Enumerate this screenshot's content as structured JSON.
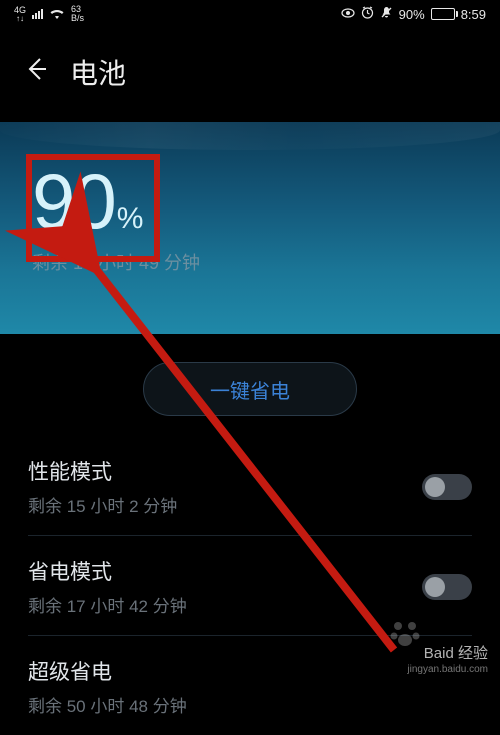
{
  "status_bar": {
    "network_type": "4G",
    "speed_value": "63",
    "speed_unit": "B/s",
    "battery_percent": "90%",
    "time": "8:59"
  },
  "header": {
    "title": "电池"
  },
  "hero": {
    "percent": "90",
    "percent_symbol": "%",
    "remaining": "剩余 15 小时 49 分钟"
  },
  "actions": {
    "one_key_save": "一键省电"
  },
  "settings": [
    {
      "title": "性能模式",
      "sub": "剩余 15 小时 2 分钟"
    },
    {
      "title": "省电模式",
      "sub": "剩余 17 小时 42 分钟"
    },
    {
      "title": "超级省电",
      "sub": "剩余 50 小时 48 分钟"
    }
  ],
  "watermark": {
    "brand": "Baid 经验",
    "url": "jingyan.baidu.com"
  },
  "icons": {
    "eye": "👁",
    "alarm": "⏰",
    "mute": "🔕"
  }
}
